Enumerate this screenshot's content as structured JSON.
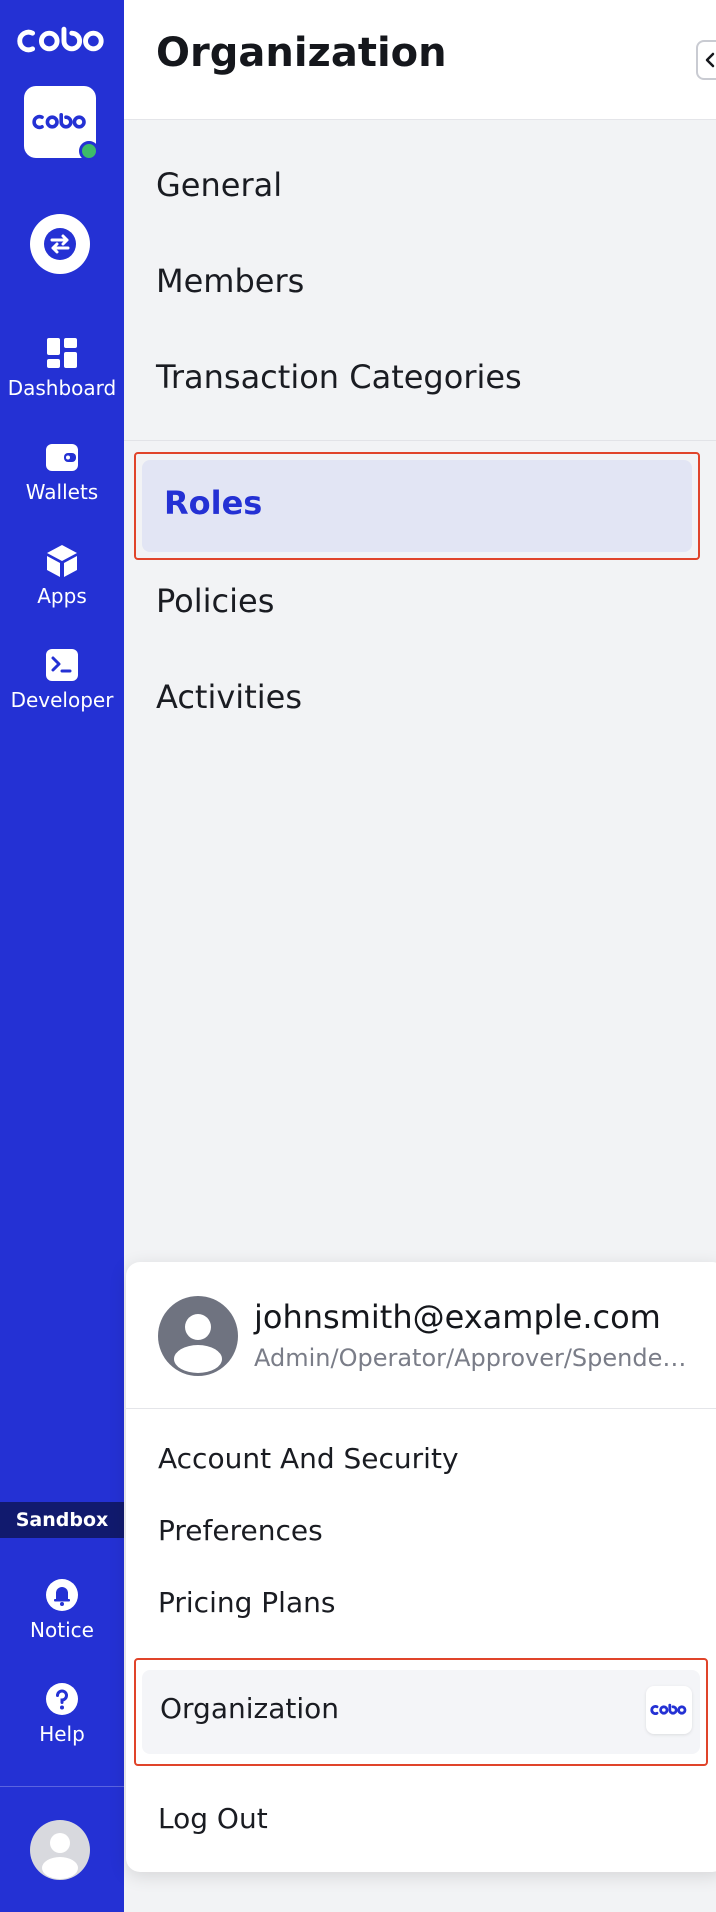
{
  "brand": {
    "logo_icon": "cobo-logo-icon",
    "accent": "#2431d4",
    "status_dot_color": "#3dbb6a"
  },
  "rail": {
    "items": [
      {
        "label": "Dashboard",
        "icon": "grid-icon"
      },
      {
        "label": "Wallets",
        "icon": "wallet-icon"
      },
      {
        "label": "Apps",
        "icon": "cube-icon"
      },
      {
        "label": "Developer",
        "icon": "terminal-icon"
      }
    ],
    "environment_badge": "Sandbox",
    "bottom_items": [
      {
        "label": "Notice",
        "icon": "bell-icon"
      },
      {
        "label": "Help",
        "icon": "question-icon"
      }
    ]
  },
  "panel": {
    "title": "Organization",
    "menu": [
      {
        "label": "General"
      },
      {
        "label": "Members"
      },
      {
        "label": "Transaction Categories"
      },
      {
        "label": "Roles",
        "selected": true
      },
      {
        "label": "Policies"
      },
      {
        "label": "Activities"
      }
    ]
  },
  "account_menu": {
    "email": "johnsmith@example.com",
    "roles": "Admin/Operator/Approver/Spender/Viewer",
    "items": [
      {
        "label": "Account And Security"
      },
      {
        "label": "Preferences"
      },
      {
        "label": "Pricing Plans"
      },
      {
        "label": "Organization",
        "highlighted": true
      },
      {
        "label": "Log Out"
      }
    ]
  }
}
